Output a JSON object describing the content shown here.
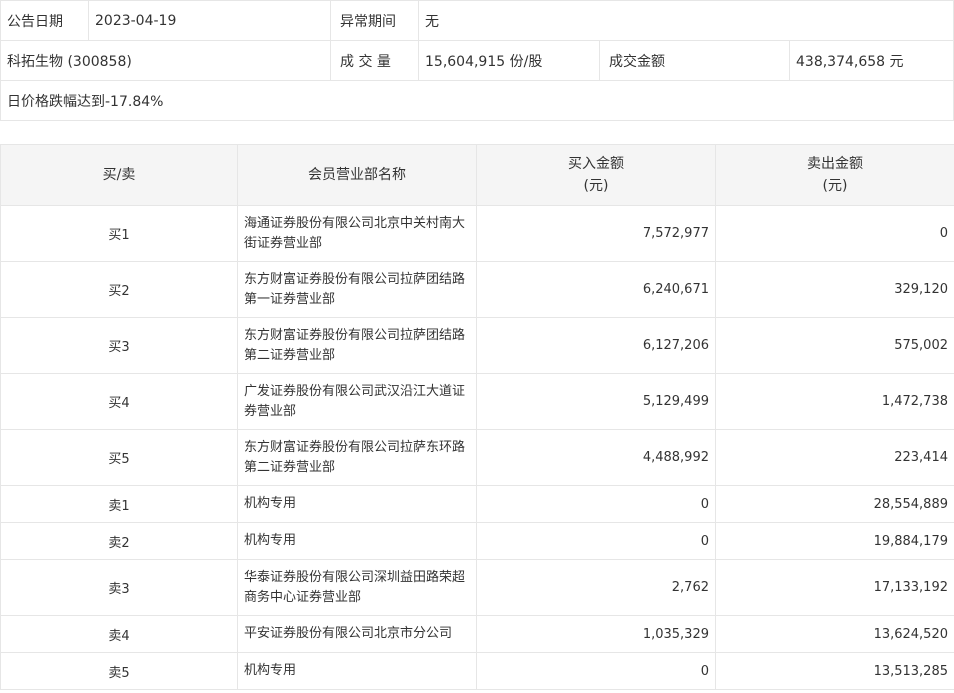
{
  "notice": {
    "date_label": "公告日期",
    "date_value": "2023-04-19",
    "period_label": "异常期间",
    "period_value": "无",
    "stock_name": "科拓生物 (300858)",
    "volume_label": "成 交 量",
    "volume_value": "15,604,915 份/股",
    "amount_label": "成交金额",
    "amount_value": "438,374,658 元",
    "reason": "日价格跌幅达到-17.84%"
  },
  "table": {
    "headers": {
      "side": "买/卖",
      "member": "会员营业部名称",
      "buy": "买入金额",
      "buy_unit": "(元)",
      "sell": "卖出金额",
      "sell_unit": "(元)"
    },
    "rows": [
      {
        "side": "买1",
        "member": "海通证券股份有限公司北京中关村南大街证券营业部",
        "buy": "7,572,977",
        "sell": "0"
      },
      {
        "side": "买2",
        "member": "东方财富证券股份有限公司拉萨团结路第一证券营业部",
        "buy": "6,240,671",
        "sell": "329,120"
      },
      {
        "side": "买3",
        "member": "东方财富证券股份有限公司拉萨团结路第二证券营业部",
        "buy": "6,127,206",
        "sell": "575,002"
      },
      {
        "side": "买4",
        "member": "广发证券股份有限公司武汉沿江大道证券营业部",
        "buy": "5,129,499",
        "sell": "1,472,738"
      },
      {
        "side": "买5",
        "member": "东方财富证券股份有限公司拉萨东环路第二证券营业部",
        "buy": "4,488,992",
        "sell": "223,414"
      },
      {
        "side": "卖1",
        "member": "机构专用",
        "buy": "0",
        "sell": "28,554,889"
      },
      {
        "side": "卖2",
        "member": "机构专用",
        "buy": "0",
        "sell": "19,884,179"
      },
      {
        "side": "卖3",
        "member": "华泰证券股份有限公司深圳益田路荣超商务中心证券营业部",
        "buy": "2,762",
        "sell": "17,133,192"
      },
      {
        "side": "卖4",
        "member": "平安证券股份有限公司北京市分公司",
        "buy": "1,035,329",
        "sell": "13,624,520"
      },
      {
        "side": "卖5",
        "member": "机构专用",
        "buy": "0",
        "sell": "13,513,285"
      }
    ]
  }
}
